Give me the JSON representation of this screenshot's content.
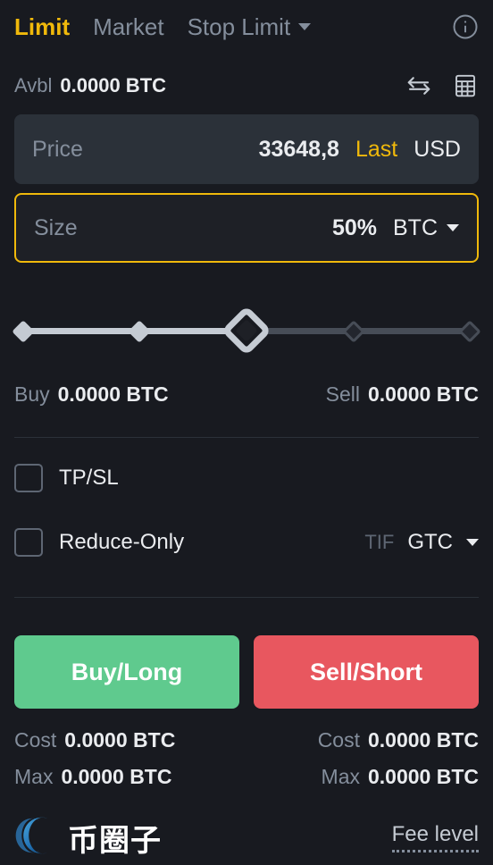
{
  "order_form": {
    "tabs": [
      {
        "label": "Limit",
        "active": true
      },
      {
        "label": "Market",
        "active": false
      },
      {
        "label": "Stop Limit",
        "active": false,
        "has_dropdown": true
      }
    ],
    "info_icon": "info-circle-icon",
    "available": {
      "label": "Avbl",
      "value": "0.0000 BTC"
    },
    "header_icons": [
      "transfer-arrows-icon",
      "calculator-icon"
    ],
    "price_field": {
      "placeholder": "Price",
      "value": "33648,8",
      "mode": "Last",
      "currency": "USD"
    },
    "size_field": {
      "placeholder": "Size",
      "value": "50%",
      "unit": "BTC",
      "unit_dropdown_icon": "chevron-down-icon"
    },
    "slider": {
      "percent": 50,
      "stops": [
        0,
        25,
        50,
        75,
        100
      ]
    },
    "estimates": {
      "buy_label": "Buy",
      "buy_value": "0.0000 BTC",
      "sell_label": "Sell",
      "sell_value": "0.0000 BTC"
    },
    "options": {
      "tpsl_label": "TP/SL",
      "tpsl_checked": false,
      "reduce_only_label": "Reduce-Only",
      "reduce_only_checked": false,
      "tif_label": "TIF",
      "tif_value": "GTC",
      "tif_dropdown_icon": "chevron-down-icon"
    },
    "buttons": {
      "buy_label": "Buy/Long",
      "sell_label": "Sell/Short"
    },
    "summary": {
      "buy_cost_label": "Cost",
      "buy_cost_value": "0.0000 BTC",
      "sell_cost_label": "Cost",
      "sell_cost_value": "0.0000 BTC",
      "buy_max_label": "Max",
      "buy_max_value": "0.0000 BTC",
      "sell_max_label": "Max",
      "sell_max_value": "0.0000 BTC"
    },
    "footer": {
      "watermark_text": "币圈子",
      "watermark_logo": "swirl-logo-icon",
      "fee_level_label": "Fee level"
    },
    "colors": {
      "accent": "#f0b90b",
      "buy": "#5fca8e",
      "sell": "#e8575f",
      "background": "#181a20",
      "field_background": "#2b3139",
      "muted_text": "#848e9c",
      "primary_text": "#eaecef"
    }
  }
}
